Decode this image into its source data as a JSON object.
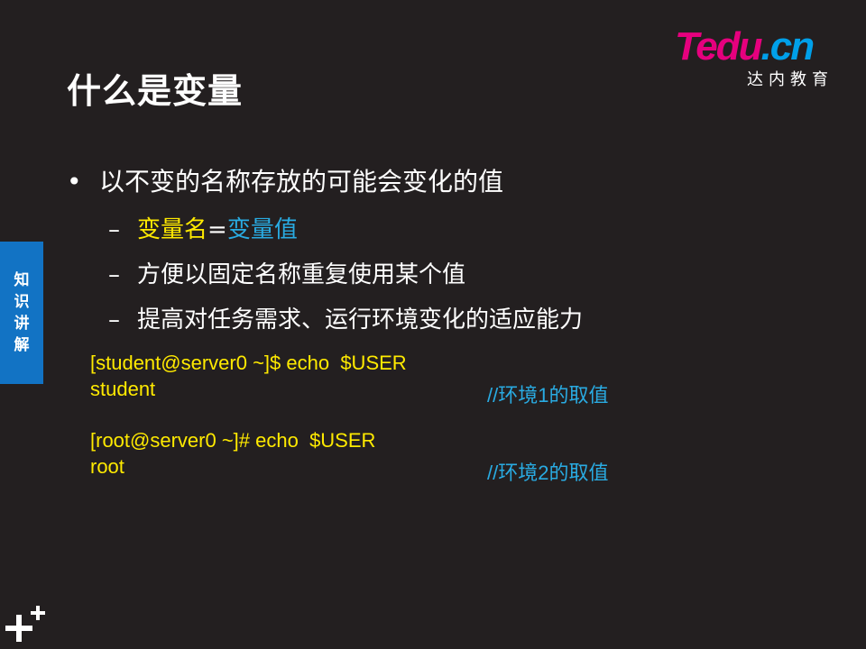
{
  "logo": {
    "te": "Te",
    "du": "du",
    "dot": ".",
    "cn": "cn",
    "sub": "达内教育"
  },
  "title": "什么是变量",
  "side_tab": [
    "知",
    "识",
    "讲",
    "解"
  ],
  "bullet": {
    "symbol": "•",
    "text": "以不变的名称存放的可能会变化的值"
  },
  "sub_items": {
    "dash": "–",
    "item1": {
      "part1": "变量名",
      "eq": "=",
      "part2": "变量值"
    },
    "item2": "方便以固定名称重复使用某个值",
    "item3": "提高对任务需求、运行环境变化的适应能力"
  },
  "code": {
    "line1": "[student@server0 ~]$ echo  $USER",
    "line2": "student",
    "comment1": "//环境1的取值",
    "line3": "[root@server0 ~]# echo  $USER",
    "line4": "root",
    "comment2": "//环境2的取值"
  },
  "colors": {
    "background": "#231f20",
    "yellow": "#ffea00",
    "cyan": "#29abe2",
    "tab_blue": "#1273c4",
    "brand_pink": "#e6007e"
  }
}
